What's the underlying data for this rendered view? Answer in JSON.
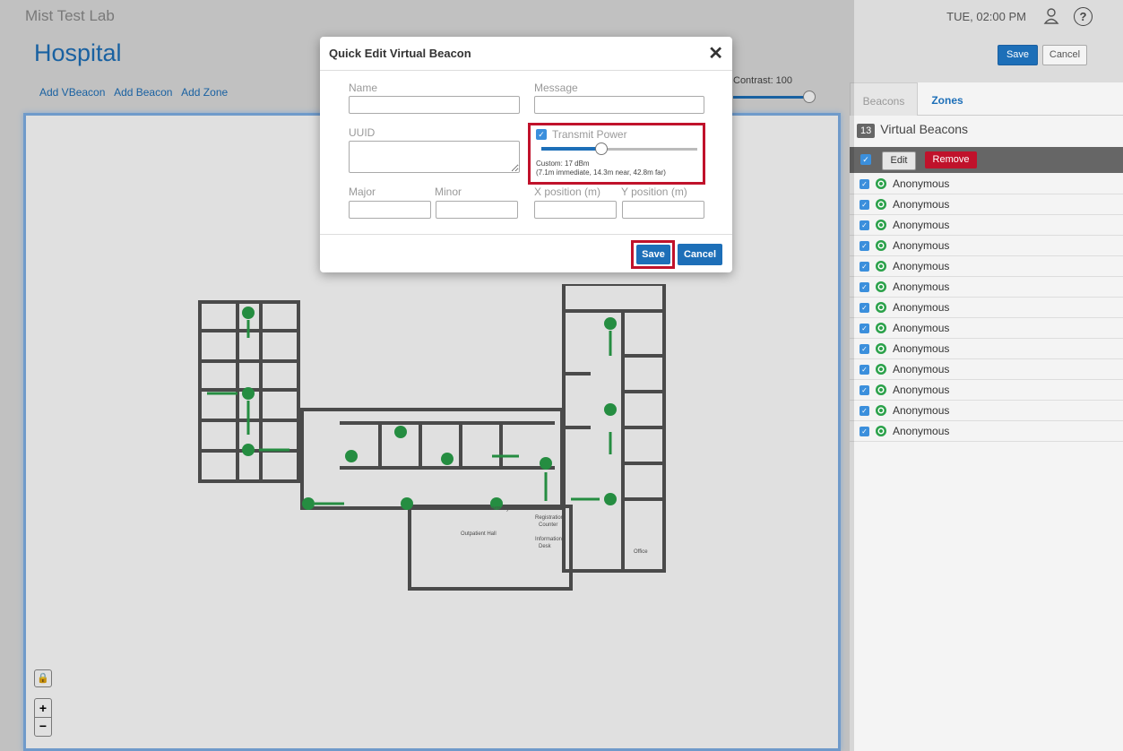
{
  "topbar": {
    "org_name": "Mist Test Lab",
    "datetime": "TUE, 02:00 PM",
    "help_glyph": "?"
  },
  "header": {
    "title": "Hospital",
    "save_label": "Save",
    "cancel_label": "Cancel"
  },
  "map_tools": {
    "add_vbeacon": "Add VBeacon",
    "add_beacon": "Add Beacon",
    "add_zone": "Add Zone"
  },
  "contrast": {
    "label": "Contrast: 100",
    "value": 100
  },
  "map_controls": {
    "lock_glyph": "🔒",
    "zoom_in": "+",
    "zoom_out": "−"
  },
  "side_panel": {
    "tabs": [
      {
        "label": "Beacons"
      },
      {
        "label": "Zones"
      }
    ],
    "count": "13",
    "count_label": "Virtual Beacons",
    "edit_label": "Edit",
    "remove_label": "Remove",
    "items": [
      {
        "name": "Anonymous"
      },
      {
        "name": "Anonymous"
      },
      {
        "name": "Anonymous"
      },
      {
        "name": "Anonymous"
      },
      {
        "name": "Anonymous"
      },
      {
        "name": "Anonymous"
      },
      {
        "name": "Anonymous"
      },
      {
        "name": "Anonymous"
      },
      {
        "name": "Anonymous"
      },
      {
        "name": "Anonymous"
      },
      {
        "name": "Anonymous"
      },
      {
        "name": "Anonymous"
      },
      {
        "name": "Anonymous"
      }
    ]
  },
  "floorplan": {
    "labels": {
      "pharmacy": "Pharmacy",
      "registration": "Registration",
      "counter": "Counter",
      "outpatient": "Outpatient Hall",
      "information": "Information",
      "desk": "Desk",
      "office": "Office"
    }
  },
  "modal": {
    "title": "Quick Edit Virtual Beacon",
    "close": "✕",
    "fields": {
      "name": {
        "label": "Name",
        "value": ""
      },
      "message": {
        "label": "Message",
        "value": ""
      },
      "uuid": {
        "label": "UUID",
        "value": ""
      },
      "major": {
        "label": "Major",
        "value": ""
      },
      "minor": {
        "label": "Minor",
        "value": ""
      },
      "x_position": {
        "label": "X position (m)",
        "value": ""
      },
      "y_position": {
        "label": "Y position (m)",
        "value": ""
      }
    },
    "transmit_power": {
      "label": "Transmit Power",
      "checked": true,
      "level": 0.32,
      "note1": "Custom: 17 dBm",
      "note2": "(7.1m immediate, 14.3m near, 42.8m far)"
    },
    "save_label": "Save",
    "cancel_label": "Cancel"
  },
  "colors": {
    "accent": "#1d6fb8",
    "danger": "#c0122b",
    "beacon": "#2ba14a"
  }
}
